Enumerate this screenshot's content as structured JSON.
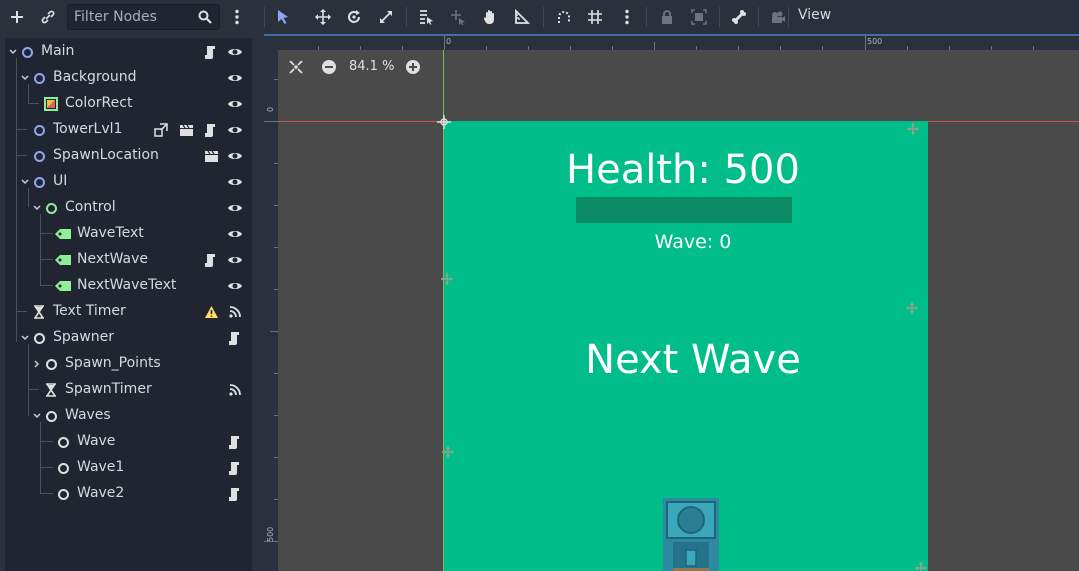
{
  "scene_panel": {
    "filter_placeholder": "Filter Nodes",
    "icons": {
      "add": "plus-icon",
      "link": "link-icon",
      "search": "search-icon",
      "menu": "vertical-dots-icon"
    },
    "nodes": [
      {
        "label": "Main",
        "depth": 0,
        "expanded": true,
        "icon": "node2d-circle-icon",
        "right_icons": [
          "script-icon",
          "visibility-eye-icon"
        ]
      },
      {
        "label": "Background",
        "depth": 1,
        "expanded": true,
        "icon": "node2d-circle-icon",
        "right_icons": [
          "visibility-eye-icon"
        ]
      },
      {
        "label": "ColorRect",
        "depth": 2,
        "icon": "colorrect-icon",
        "right_icons": [
          "visibility-eye-icon"
        ]
      },
      {
        "label": "TowerLvl1",
        "depth": 1,
        "icon": "node2d-circle-icon",
        "right_icons": [
          "instance-link-icon",
          "clapperboard-icon",
          "script-icon",
          "visibility-eye-icon"
        ]
      },
      {
        "label": "SpawnLocation",
        "depth": 1,
        "icon": "node2d-circle-icon",
        "right_icons": [
          "clapperboard-icon",
          "visibility-eye-icon"
        ]
      },
      {
        "label": "UI",
        "depth": 1,
        "expanded": true,
        "icon": "node2d-circle-icon",
        "right_icons": [
          "visibility-eye-icon"
        ]
      },
      {
        "label": "Control",
        "depth": 2,
        "expanded": true,
        "icon": "control-circle-icon",
        "right_icons": [
          "visibility-eye-icon"
        ]
      },
      {
        "label": "WaveText",
        "depth": 3,
        "icon": "label-tag-icon",
        "right_icons": [
          "visibility-eye-icon"
        ]
      },
      {
        "label": "NextWave",
        "depth": 3,
        "icon": "label-tag-icon",
        "right_icons": [
          "script-icon",
          "visibility-eye-icon"
        ]
      },
      {
        "label": "NextWaveText",
        "depth": 3,
        "icon": "label-tag-icon",
        "right_icons": [
          "visibility-eye-icon"
        ]
      },
      {
        "label": "Text Timer",
        "depth": 1,
        "icon": "timer-hourglass-icon",
        "right_icons": [
          "warning-icon",
          "signal-icon"
        ]
      },
      {
        "label": "Spawner",
        "depth": 1,
        "expanded": true,
        "icon": "node-circle-icon",
        "right_icons": [
          "script-icon"
        ]
      },
      {
        "label": "Spawn_Points",
        "depth": 2,
        "collapsed": true,
        "icon": "node-circle-icon",
        "right_icons": []
      },
      {
        "label": "SpawnTimer",
        "depth": 2,
        "icon": "timer-hourglass-icon",
        "right_icons": [
          "signal-icon"
        ]
      },
      {
        "label": "Waves",
        "depth": 2,
        "expanded": true,
        "icon": "node-circle-icon",
        "right_icons": []
      },
      {
        "label": "Wave",
        "depth": 3,
        "icon": "node-circle-icon",
        "right_icons": [
          "script-icon"
        ]
      },
      {
        "label": "Wave1",
        "depth": 3,
        "icon": "node-circle-icon",
        "right_icons": [
          "script-icon"
        ]
      },
      {
        "label": "Wave2",
        "depth": 3,
        "icon": "node-circle-icon",
        "right_icons": [
          "script-icon"
        ]
      }
    ]
  },
  "editor_toolbar": {
    "tools": [
      "select-arrow-icon",
      "move-icon",
      "rotate-icon",
      "scale-icon",
      "list-select-icon",
      "pivot-icon",
      "pan-hand-icon",
      "ruler-icon",
      "smart-snap-icon",
      "grid-snap-icon",
      "vertical-dots-icon",
      "lock-icon",
      "group-icon",
      "bone-icon",
      "camera-icon"
    ],
    "view_label": "View"
  },
  "viewport": {
    "zoom_label": "84.1 %",
    "ruler_top": [
      "0",
      "500"
    ],
    "ruler_left": [
      "0",
      "500"
    ],
    "game": {
      "background": "#00bd89",
      "health_text": "Health: 500",
      "wave_label": "Wave:",
      "wave_value": "0",
      "next_wave_text": "Next Wave"
    }
  },
  "colors": {
    "accent": "#8da5f3",
    "panel": "#2b313c",
    "tree_bg": "#202531",
    "game_green": "#00bd89",
    "health_bar": "#0a8b64"
  }
}
